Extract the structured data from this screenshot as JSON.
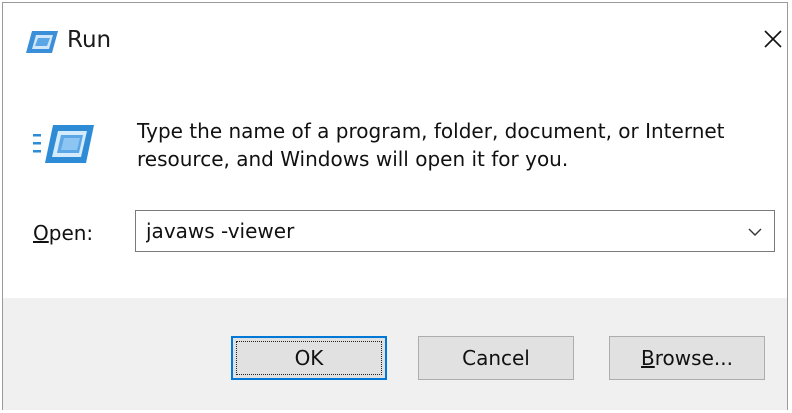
{
  "window": {
    "title": "Run",
    "close_glyph": "✕"
  },
  "icons": {
    "title_icon": "run-icon",
    "body_icon": "run-icon",
    "close_icon": "close-icon",
    "dropdown_icon": "chevron-down-icon"
  },
  "description": "Type the name of a program, folder, document, or Internet resource, and Windows will open it for you.",
  "open_field": {
    "label_accel": "O",
    "label_rest": "pen:",
    "value": "javaws -viewer"
  },
  "buttons": {
    "ok": "OK",
    "cancel": "Cancel",
    "browse_accel": "B",
    "browse_rest": "rowse..."
  },
  "colors": {
    "accent": "#0078d7",
    "icon_blue": "#2e8bd6",
    "footer_bg": "#f0f0f0",
    "button_bg": "#e1e1e1"
  }
}
